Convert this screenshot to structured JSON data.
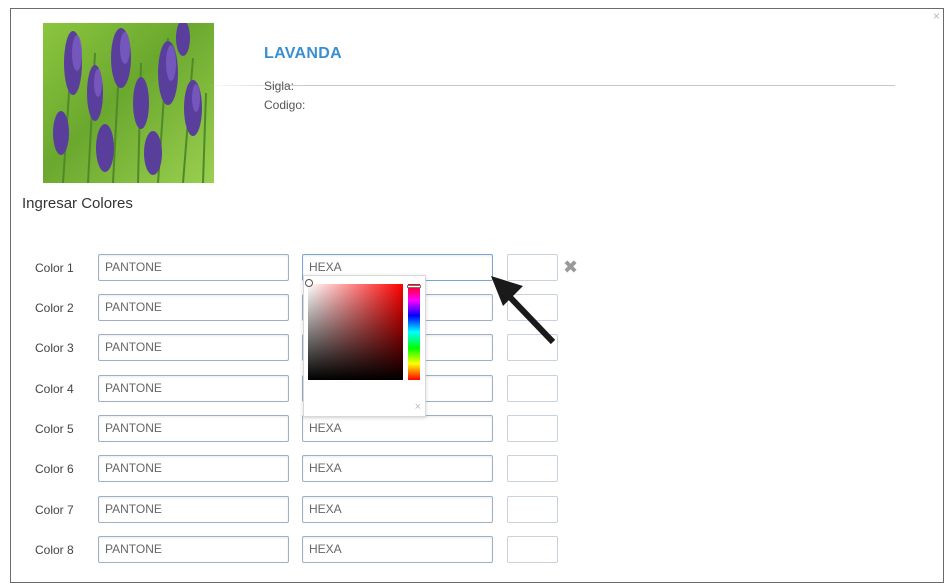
{
  "dialog": {
    "close_glyph": "×"
  },
  "product": {
    "name": "LAVANDA",
    "sigla_label": "Sigla:",
    "codigo_label": "Codigo:",
    "image_icon": "lavender-photo"
  },
  "colors_section": {
    "heading": "Ingresar Colores",
    "remove_glyph": "✖",
    "rows": [
      {
        "label": "Color 1",
        "pantone_placeholder": "PANTONE",
        "hexa_placeholder": "HEXA"
      },
      {
        "label": "Color 2",
        "pantone_placeholder": "PANTONE",
        "hexa_placeholder": ""
      },
      {
        "label": "Color 3",
        "pantone_placeholder": "PANTONE",
        "hexa_placeholder": ""
      },
      {
        "label": "Color 4",
        "pantone_placeholder": "PANTONE",
        "hexa_placeholder": ""
      },
      {
        "label": "Color 5",
        "pantone_placeholder": "PANTONE",
        "hexa_placeholder": "HEXA"
      },
      {
        "label": "Color 6",
        "pantone_placeholder": "PANTONE",
        "hexa_placeholder": "HEXA"
      },
      {
        "label": "Color 7",
        "pantone_placeholder": "PANTONE",
        "hexa_placeholder": "HEXA"
      },
      {
        "label": "Color 8",
        "pantone_placeholder": "PANTONE",
        "hexa_placeholder": "HEXA"
      }
    ]
  },
  "color_picker": {
    "close_glyph": "×",
    "base_hue": "#ff0000"
  },
  "colors": {
    "title_blue": "#3a8fd0",
    "input_border": "#9db0c6"
  }
}
